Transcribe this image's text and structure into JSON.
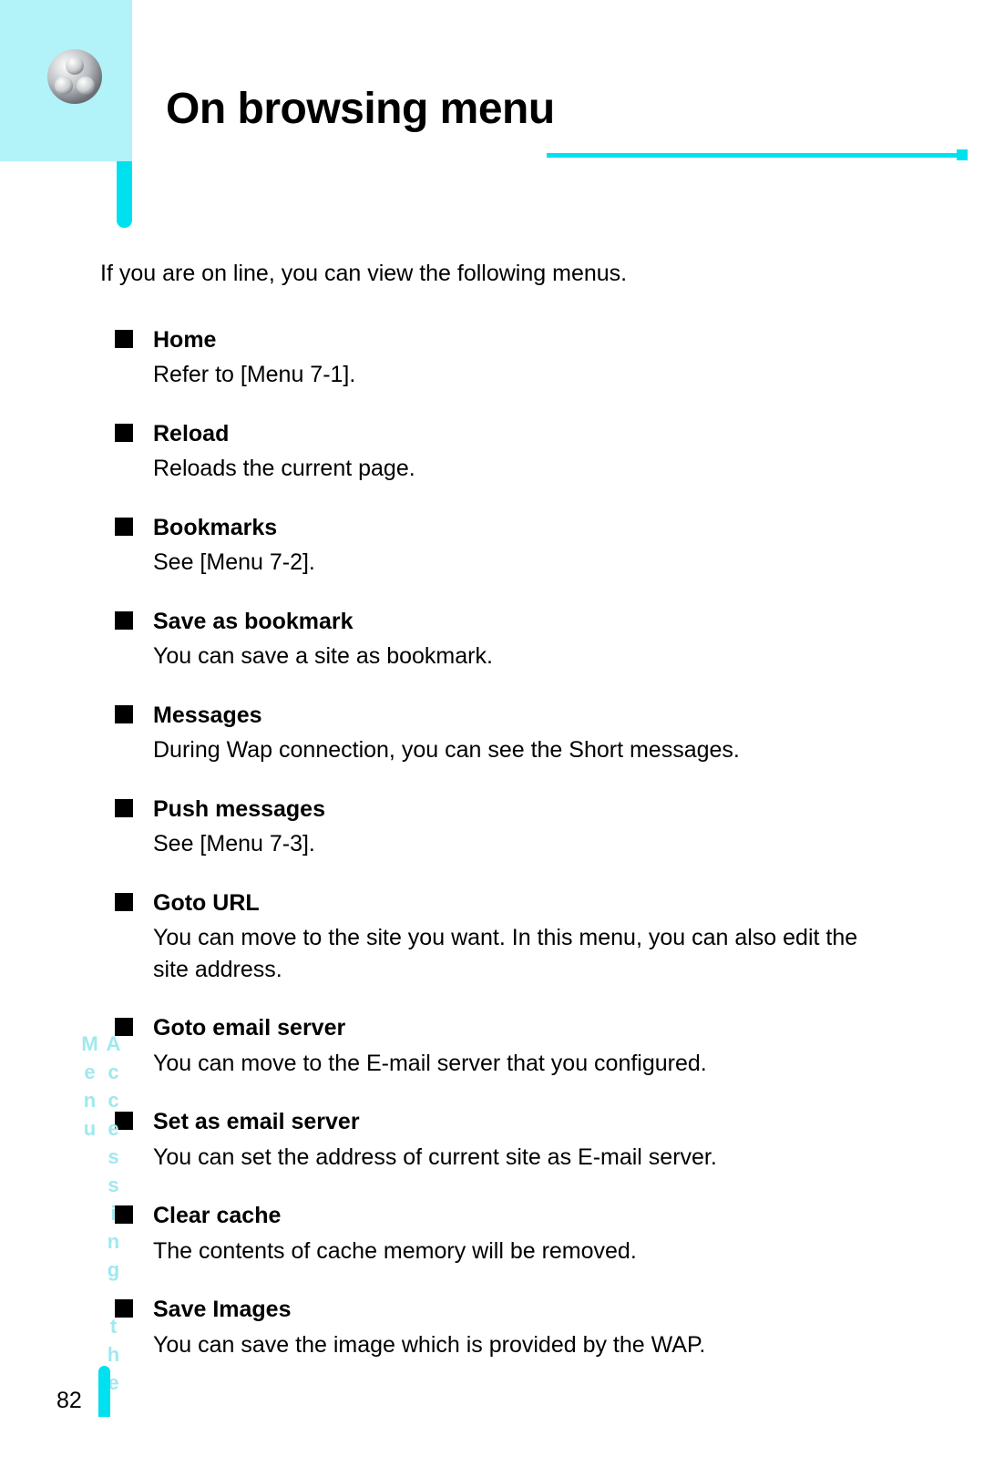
{
  "header": {
    "title": "On browsing menu"
  },
  "intro": "If you are on line, you can view the following menus.",
  "items": [
    {
      "head": "Home",
      "body": "Refer to [Menu 7-1]."
    },
    {
      "head": "Reload",
      "body": "Reloads the current page."
    },
    {
      "head": "Bookmarks",
      "body": "See [Menu 7-2]."
    },
    {
      "head": "Save as bookmark",
      "body": "You can save a site as bookmark."
    },
    {
      "head": "Messages",
      "body": "During Wap connection, you can see the Short messages."
    },
    {
      "head": "Push messages",
      "body": "See [Menu 7-3]."
    },
    {
      "head": "Goto URL",
      "body": "You can move to the site you want. In this menu, you can also edit the site address."
    },
    {
      "head": "Goto email server",
      "body": "You can move to the E-mail server that you configured."
    },
    {
      "head": "Set as email server",
      "body": "You can set the address of current site as E-mail server."
    },
    {
      "head": "Clear cache",
      "body": "The contents of cache memory will be removed."
    },
    {
      "head": "Save Images",
      "body": "You can save the image which is provided by the WAP."
    }
  ],
  "side_label": "Accessing the Menu",
  "page_number": "82"
}
